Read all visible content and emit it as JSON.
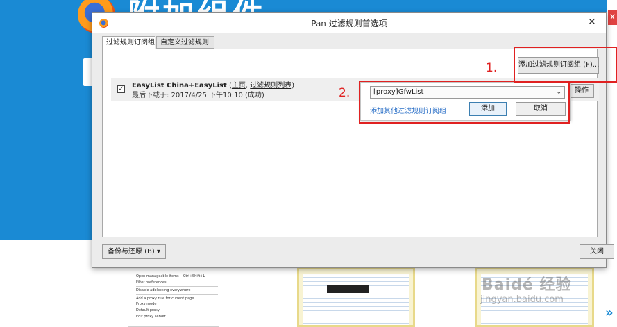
{
  "background": {
    "page_title": "附加组件",
    "close_glyph": "x"
  },
  "dialog": {
    "title": "Pan 过滤规则首选项",
    "close_glyph": "✕"
  },
  "tabs": [
    {
      "label": "过滤规则订阅组",
      "active": true
    },
    {
      "label": "自定义过滤规则",
      "active": false
    }
  ],
  "toolbar": {
    "add_subscription_label": "添加过滤规则订阅组 (F)..."
  },
  "subscription": {
    "checked": true,
    "check_glyph": "✓",
    "name": "EasyList China+EasyList",
    "link_open": " (",
    "homepage_link": "主页",
    "link_sep": ", ",
    "filter_list_link": "过滤规则列表",
    "link_close": ")",
    "status": "最后下载于:  2017/4/25 下午10:10 (成功)",
    "actions_label": "操作"
  },
  "popup": {
    "selected_option": "[proxy]GfwList",
    "arrow_glyph": "⌄",
    "more_link": "添加其他过滤规则订阅组",
    "add_button": "添加",
    "cancel_button": "取消"
  },
  "footer": {
    "backup_button": "备份与还原 (B)  ▾",
    "close_button": "关闭"
  },
  "annotations": {
    "step1": "1.",
    "step2": "2."
  },
  "thumbnail_menu": {
    "items": [
      "Open manageable items",
      "Filter preferences...",
      "Disable adblocking everywhere",
      "Add a proxy rule for current page",
      "Proxy mode",
      "Default proxy",
      "Edit proxy server"
    ],
    "shortcut": "Ctrl+Shift+L"
  },
  "watermark": {
    "text": "Baidé 经验",
    "sub": "jingyan.baidu.com"
  },
  "colors": {
    "banner_blue": "#1a8ad4",
    "annotation_red": "#e02121",
    "link_blue": "#2a6fc7"
  }
}
